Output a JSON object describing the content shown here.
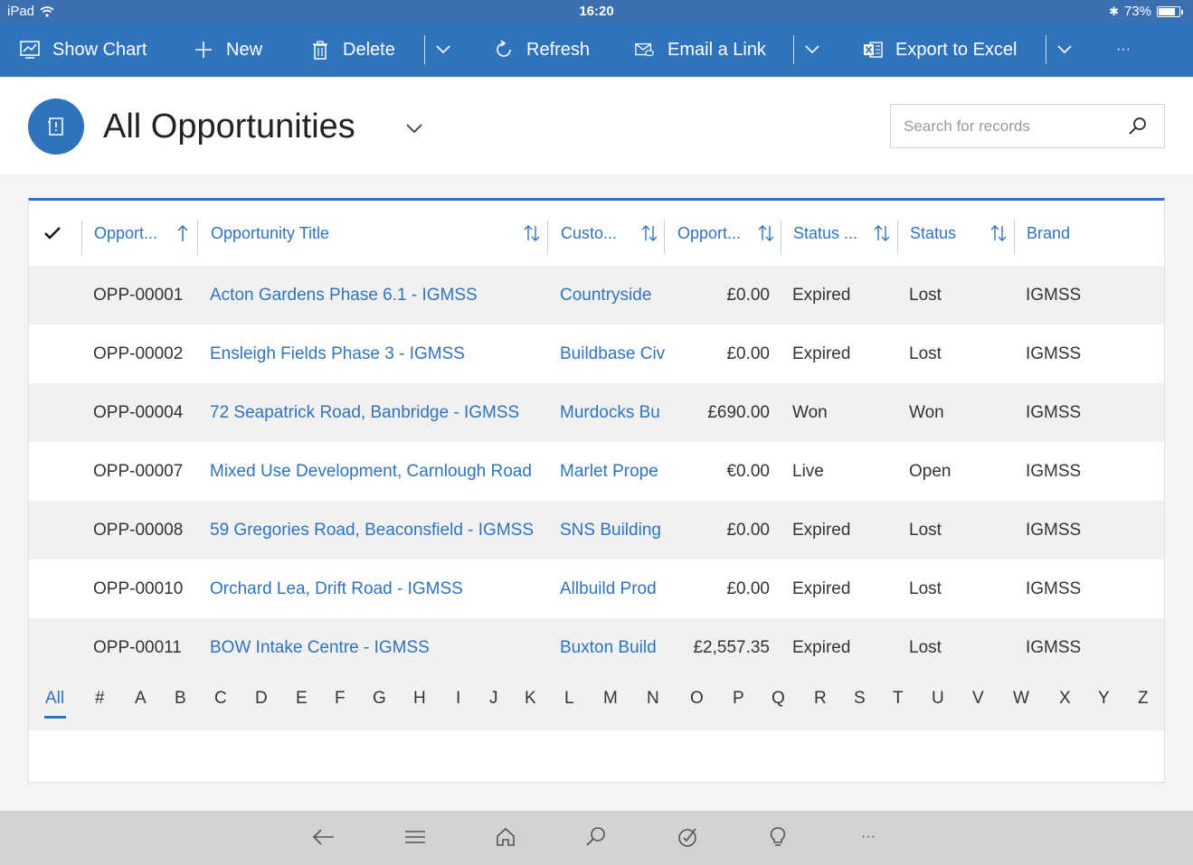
{
  "status_bar": {
    "device": "iPad",
    "time": "16:20",
    "battery": "73%"
  },
  "command_bar": {
    "show_chart": "Show Chart",
    "new": "New",
    "delete": "Delete",
    "refresh": "Refresh",
    "email_link": "Email a Link",
    "export_excel": "Export to Excel",
    "more": "···"
  },
  "header": {
    "view_title": "All Opportunities",
    "search_placeholder": "Search for records"
  },
  "grid": {
    "columns": [
      {
        "label": "Opport..."
      },
      {
        "label": "Opportunity Title"
      },
      {
        "label": "Custo..."
      },
      {
        "label": "Opport..."
      },
      {
        "label": "Status ..."
      },
      {
        "label": "Status"
      },
      {
        "label": "Brand"
      }
    ],
    "rows": [
      {
        "id": "OPP-00001",
        "title": "Acton Gardens Phase 6.1 - IGMSS",
        "customer": "Countryside",
        "value": "£0.00",
        "status_reason": "Expired",
        "status": "Lost",
        "brand": "IGMSS"
      },
      {
        "id": "OPP-00002",
        "title": "Ensleigh Fields Phase 3 - IGMSS",
        "customer": "Buildbase Civ",
        "value": "£0.00",
        "status_reason": "Expired",
        "status": "Lost",
        "brand": "IGMSS"
      },
      {
        "id": "OPP-00004",
        "title": "72 Seapatrick Road, Banbridge - IGMSS",
        "customer": "Murdocks Bu",
        "value": "£690.00",
        "status_reason": "Won",
        "status": "Won",
        "brand": "IGMSS"
      },
      {
        "id": "OPP-00007",
        "title": "Mixed Use Development, Carnlough Road",
        "customer": "Marlet Prope",
        "value": "€0.00",
        "status_reason": "Live",
        "status": "Open",
        "brand": "IGMSS"
      },
      {
        "id": "OPP-00008",
        "title": "59 Gregories Road, Beaconsfield - IGMSS",
        "customer": "SNS Building",
        "value": "£0.00",
        "status_reason": "Expired",
        "status": "Lost",
        "brand": "IGMSS"
      },
      {
        "id": "OPP-00010",
        "title": "Orchard Lea, Drift Road - IGMSS",
        "customer": "Allbuild Prod",
        "value": "£0.00",
        "status_reason": "Expired",
        "status": "Lost",
        "brand": "IGMSS"
      },
      {
        "id": "OPP-00011",
        "title": "BOW Intake Centre - IGMSS",
        "customer": "Buxton Build",
        "value": "£2,557.35",
        "status_reason": "Expired",
        "status": "Lost",
        "brand": "IGMSS"
      }
    ]
  },
  "alpha_filter": [
    "All",
    "#",
    "A",
    "B",
    "C",
    "D",
    "E",
    "F",
    "G",
    "H",
    "I",
    "J",
    "K",
    "L",
    "M",
    "N",
    "O",
    "P",
    "Q",
    "R",
    "S",
    "T",
    "U",
    "V",
    "W",
    "X",
    "Y",
    "Z"
  ],
  "bottom_nav": {
    "more": "···"
  },
  "colors": {
    "accent": "#2f73bc",
    "row_alt": "#f1f1f1"
  }
}
